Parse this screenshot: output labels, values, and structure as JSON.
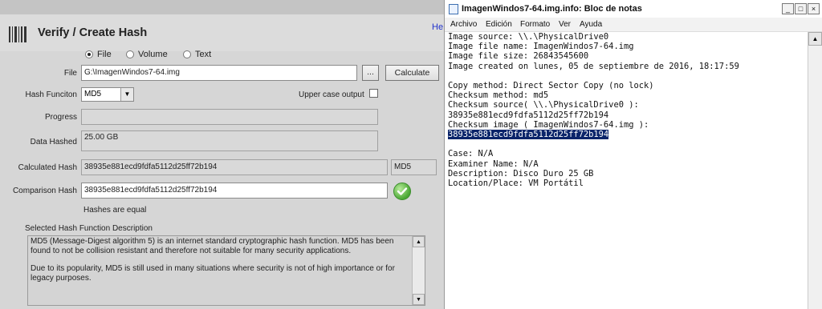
{
  "app": {
    "title": "Verify / Create Hash",
    "help_link": "He"
  },
  "mode": {
    "options": [
      "File",
      "Volume",
      "Text"
    ],
    "selected": "File"
  },
  "file": {
    "label": "File",
    "value": "G:\\ImagenWindos7-64.img",
    "browse_label": "...",
    "calculate_label": "Calculate"
  },
  "hash_function": {
    "label": "Hash Funciton",
    "value": "MD5",
    "uppercase_label": "Upper case output"
  },
  "progress": {
    "label": "Progress",
    "value": ""
  },
  "data_hashed": {
    "label": "Data Hashed",
    "value": "25.00 GB"
  },
  "calculated_hash": {
    "label": "Calculated Hash",
    "value": "38935e881ecd9fdfa5112d25ff72b194",
    "algo": "MD5"
  },
  "comparison_hash": {
    "label": "Comparison Hash",
    "value": "38935e881ecd9fdfa5112d25ff72b194",
    "status": "Hashes are equal",
    "status_icon": "check-icon"
  },
  "description": {
    "label": "Selected Hash Function Description",
    "paragraphs": [
      "MD5 (Message-Digest algorithm 5) is an internet standard cryptographic hash function. MD5 has been found to not be collision resistant and therefore not suitable for many security applications.",
      "Due to its popularity, MD5 is still used in many situations where security is not of high importance or for legacy purposes."
    ]
  },
  "notepad": {
    "title": "ImagenWindos7-64.img.info: Bloc de notas",
    "window_buttons": [
      "_",
      "□",
      "×"
    ],
    "menu": [
      "Archivo",
      "Edición",
      "Formato",
      "Ver",
      "Ayuda"
    ],
    "lines": [
      "Image source: \\\\.\\PhysicalDrive0",
      "Image file name: ImagenWindos7-64.img",
      "Image file size: 26843545600",
      "Image created on lunes, 05 de septiembre de 2016, 18:17:59",
      "",
      "Copy method: Direct Sector Copy (no lock)",
      "Checksum method: md5",
      "Checksum source( \\\\.\\PhysicalDrive0 ):",
      "38935e881ecd9fdfa5112d25ff72b194",
      "Checksum image ( ImagenWindos7-64.img ):",
      "38935e881ecd9fdfa5112d25ff72b194",
      "",
      "Case: N/A",
      "Examiner Name: N/A",
      "Description: Disco Duro 25 GB",
      "Location/Place: VM Portátil"
    ],
    "selected_line_index": 10
  }
}
